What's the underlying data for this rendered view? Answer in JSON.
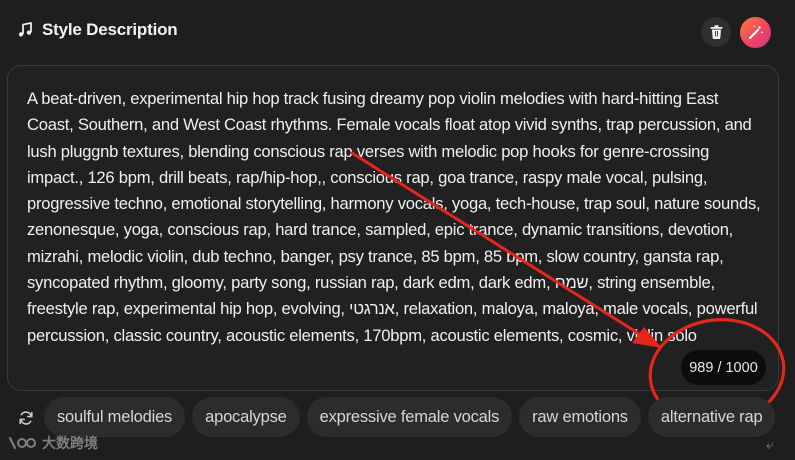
{
  "header": {
    "title": "Style Description",
    "icons": {
      "title": "music-note-icon",
      "delete": "trash-icon",
      "enhance": "magic-wand-icon"
    },
    "enhance_gradient": [
      "#ff7a3d",
      "#f0455f",
      "#c93a8a"
    ]
  },
  "editor": {
    "text": "A beat-driven, experimental hip hop track fusing dreamy pop violin melodies with hard-hitting East Coast, Southern, and West Coast rhythms. Female vocals float atop vivid synths, trap percussion, and lush pluggnb textures, blending conscious rap verses with melodic pop hooks for genre-crossing impact., 126 bpm, drill beats, rap/hip-hop,, conscious rap, goa trance, raspy male vocal, pulsing, progressive techno, emotional storytelling, harmony vocals, yoga, tech-house, trap soul, nature sounds, zenonesque, yoga, conscious rap, hard trance, sampled, epic trance, dynamic transitions, devotion, mizrahi, melodic violin, dub techno, banger, psy trance, 85 bpm, 85 bpm, slow country, gansta rap, syncopated rhythm, gloomy, party song, russian rap, dark edm, dark edm, שמח, string ensemble, freestyle rap, experimental hip hop, evolving, אנרגטי, relaxation, maloya, maloya, male vocals, powerful percussion, classic country, acoustic elements, 170bpm, acoustic elements, cosmic, violin solo",
    "char_count": "989 / 1000"
  },
  "annotation": {
    "color": "#e5261c"
  },
  "tags": {
    "refresh_icon": "refresh-icon",
    "items": [
      "soulful melodies",
      "apocalypse",
      "expressive female vocals",
      "raw emotions",
      "alternative rap"
    ]
  },
  "watermark": {
    "text": "大数跨境"
  }
}
